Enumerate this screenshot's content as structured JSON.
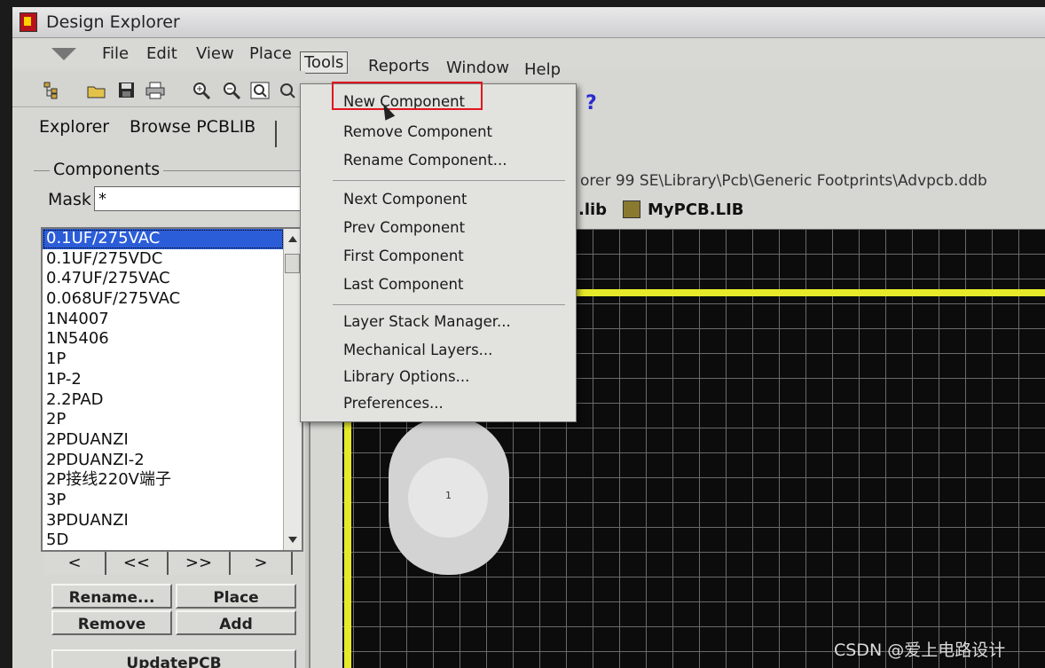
{
  "window": {
    "title": "Design Explorer"
  },
  "menubar": {
    "items": [
      "File",
      "Edit",
      "View",
      "Place",
      "Tools",
      "Reports",
      "Window",
      "Help"
    ]
  },
  "left_panel": {
    "tabs": [
      "Explorer",
      "Browse PCBLIB"
    ],
    "group_title": "Components",
    "mask_label": "Mask",
    "mask_value": "*",
    "components": [
      "0.1UF/275VAC",
      "0.1UF/275VDC",
      "0.47UF/275VAC",
      "0.068UF/275VAC",
      "1N4007",
      "1N5406",
      "1P",
      "1P-2",
      "2.2PAD",
      "2P",
      "2PDUANZI",
      "2PDUANZI-2",
      "2P接线220V端子",
      "3P",
      "3PDUANZI",
      "5D"
    ],
    "selected_index": 0,
    "nav_buttons": [
      "<",
      "<<",
      ">>",
      ">"
    ],
    "buttons": {
      "rename": "Rename...",
      "place": "Place",
      "remove": "Remove",
      "add": "Add",
      "update": "UpdatePCB"
    }
  },
  "document": {
    "path": "orer 99 SE\\Library\\Pcb\\Generic Footprints\\Advpcb.ddb",
    "tabs": [
      ".lib",
      "MyPCB.LIB"
    ],
    "pad_label": "1"
  },
  "tools_menu": {
    "items": [
      "New Component",
      "Remove Component",
      "Rename Component...",
      "Next Component",
      "Prev Component",
      "First Component",
      "Last Component",
      "Layer Stack Manager...",
      "Mechanical Layers...",
      "Library Options...",
      "Preferences..."
    ],
    "highlighted": "New Component"
  },
  "colors": {
    "highlight_box": "#e0161f",
    "selection": "#2c5dd9",
    "board_edge": "#e6ea2a"
  },
  "watermark": "CSDN @爱上电路设计"
}
